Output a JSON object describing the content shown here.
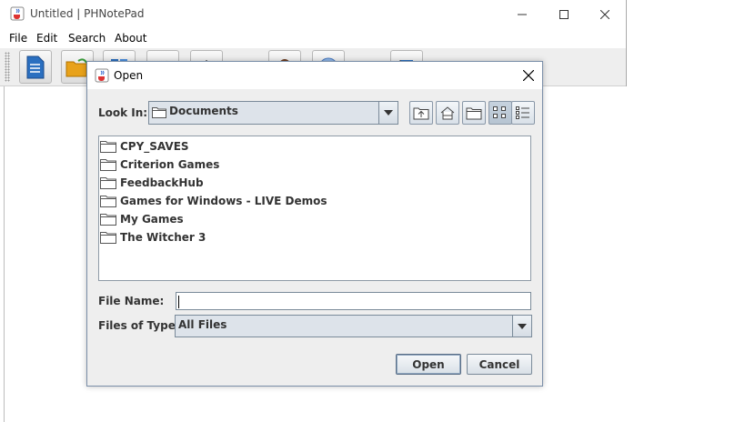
{
  "app": {
    "title": "Untitled | PHNotePad",
    "menu": [
      "File",
      "Edit",
      "Search",
      "About"
    ],
    "toolbar_icons": [
      "new-document-icon",
      "open-folder-icon",
      "book-icon",
      "brush-icon",
      "palette-icon",
      "person-icon",
      "globe-icon",
      "flag-icon"
    ]
  },
  "dialog": {
    "title": "Open",
    "look_in_label": "Look In:",
    "look_in_value": "Documents",
    "items": [
      "CPY_SAVES",
      "Criterion Games",
      "FeedbackHub",
      "Games for Windows - LIVE Demos",
      "My Games",
      "The Witcher 3"
    ],
    "file_name_label": "File Name:",
    "file_name_value": "",
    "files_of_type_label": "Files of Type:",
    "files_of_type_value": "All Files",
    "open_button": "Open",
    "cancel_button": "Cancel"
  }
}
